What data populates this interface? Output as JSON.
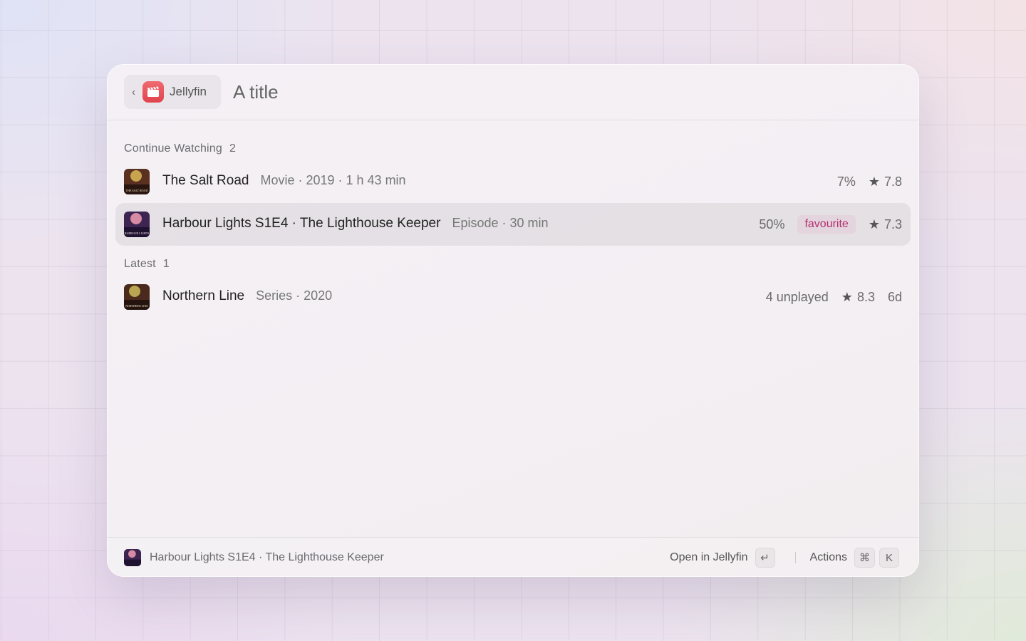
{
  "header": {
    "back_label": "Jellyfin",
    "title": "A title",
    "app_icon": "clapperboard-icon",
    "accent": "#e0424c"
  },
  "sections": [
    {
      "label": "Continue Watching",
      "count": "2",
      "items": [
        {
          "title": "The Salt Road",
          "subtitle": "Movie · 2019 · 1 h 43 min",
          "progress": "7%",
          "rating": "7.8",
          "poster_text": "THE SALT ROAD",
          "poster_colors": [
            "#5a3021",
            "#c9a44f"
          ]
        },
        {
          "title": "Harbour Lights S1E4 · The Lighthouse Keeper",
          "subtitle": "Episode · 30 min",
          "progress": "50%",
          "tag": "favourite",
          "rating": "7.3",
          "poster_text": "HARBOUR LIGHTS",
          "poster_colors": [
            "#3d2552",
            "#d78aa3"
          ],
          "selected": true
        }
      ]
    },
    {
      "label": "Latest",
      "count": "1",
      "items": [
        {
          "title": "Northern Line",
          "subtitle": "Series · 2020",
          "unplayed": "4 unplayed",
          "rating": "8.3",
          "age": "6d",
          "poster_text": "NORTHERN LINE",
          "poster_colors": [
            "#4a2a1c",
            "#b9a552"
          ]
        }
      ]
    }
  ],
  "footer": {
    "selected_title": "Harbour Lights S1E4 · The Lighthouse Keeper",
    "primary_action": "Open in Jellyfin",
    "primary_key": "↵",
    "actions_label": "Actions",
    "actions_keys": [
      "⌘",
      "K"
    ]
  }
}
